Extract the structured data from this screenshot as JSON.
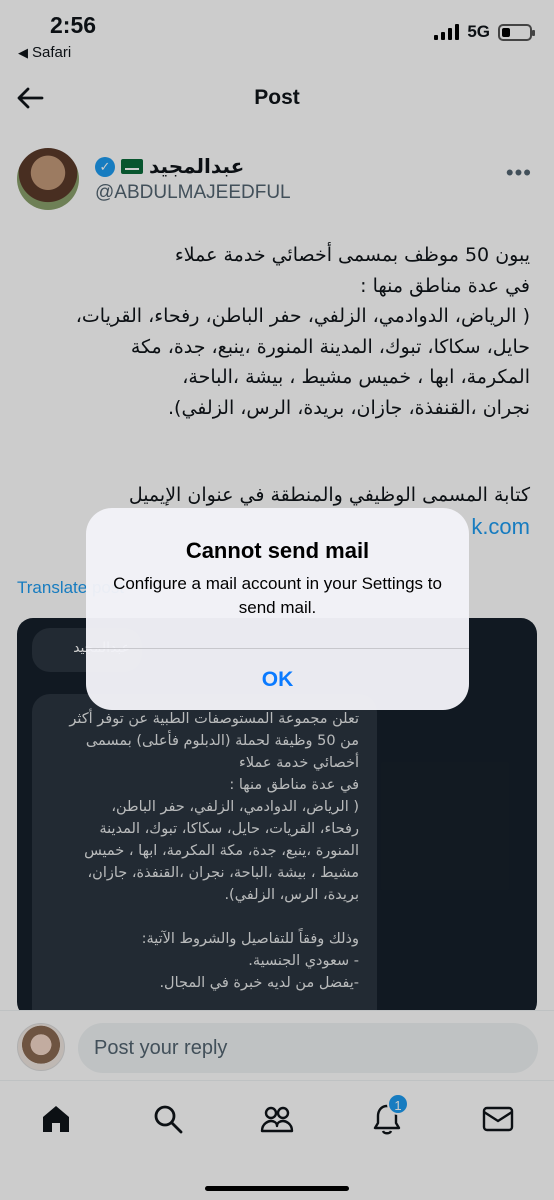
{
  "status_bar": {
    "time": "2:56",
    "back_app": "Safari",
    "network": "5G"
  },
  "header": {
    "title": "Post"
  },
  "author": {
    "name": "عبدالمجيد",
    "handle": "@ABDULMAJEEDFUL",
    "verified": true
  },
  "tweet": {
    "text": "يبون 50 موظف بمسمى أخصائي خدمة عملاء\nفي عدة مناطق منها :\n( الرياض، الدوادمي، الزلفي، حفر الباطن، رفحاء، القريات،\nحايل، سكاكا، تبوك، المدينة المنورة ،ينبع، جدة، مكة\nالمكرمة، ابها ، خميس مشيط ، بيشة ،الباحة،\nنجران ،القنفذة، جازان، بريدة، الرس، الزلفي).",
    "text2": "كتابة المسمى الوظيفي والمنطقة في عنوان الإيميل",
    "email_fragment": "k.com",
    "translate_label": "Translate post"
  },
  "embed": {
    "bubble1": "عبدالمجيد",
    "bubble2": "تعلن مجموعة المستوصفات الطبية عن توفر أكثر\nمن 50 وظيفة لحملة (الدبلوم فأعلى) بمسمى\nأخصائي خدمة عملاء\nفي عدة مناطق منها :\n( الرياض، الدوادمي، الزلفي، حفر الباطن،\nرفحاء، القريات، حايل، سكاكا، تبوك، المدينة\nالمنورة ،ينبع، جدة، مكة المكرمة، ابها ، خميس\nمشيط ، بيشة ،الباحة، نجران ،القنفذة، جازان،\nبريدة، الرس، الزلفي).\n\nوذلك وفقاً للتفاصيل والشروط الآتية:\n- سعودي الجنسية.\n-يفضل من لديه خبرة في المجال."
  },
  "reply": {
    "placeholder": "Post your reply"
  },
  "tabs": {
    "notifications_badge": "1"
  },
  "alert": {
    "title": "Cannot send mail",
    "message": "Configure a mail account in your Settings to send mail.",
    "ok_label": "OK"
  },
  "colors": {
    "accent": "#1d9bf0",
    "ios_blue": "#0a7aff",
    "secondary_text": "#536471"
  }
}
